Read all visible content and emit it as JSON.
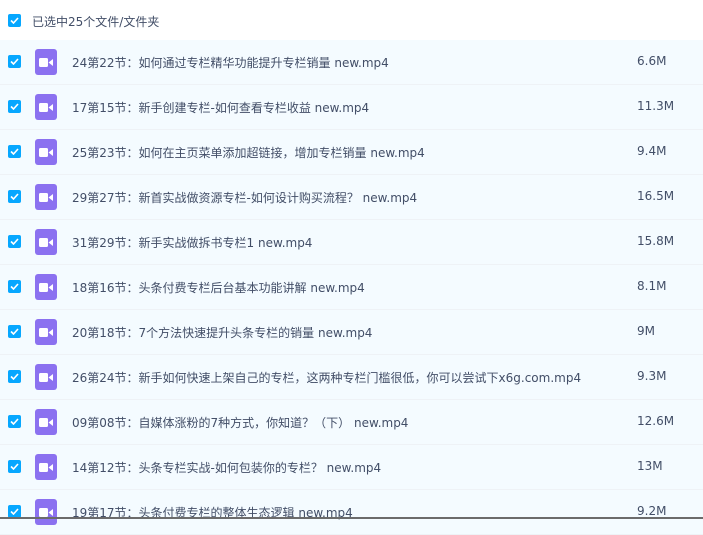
{
  "header": {
    "label": "已选中25个文件/文件夹"
  },
  "colors": {
    "accent": "#06a7ff",
    "video_icon": "#8b71f0",
    "row_bg": "#f4fbff"
  },
  "files": [
    {
      "name": "24第22节：如何通过专栏精华功能提升专栏销量 new.mp4",
      "size": "6.6M",
      "icon": "video-file-icon",
      "checked": true
    },
    {
      "name": "17第15节：新手创建专栏-如何查看专栏收益 new.mp4",
      "size": "11.3M",
      "icon": "video-file-icon",
      "checked": true
    },
    {
      "name": "25第23节：如何在主页菜单添加超链接，增加专栏销量 new.mp4",
      "size": "9.4M",
      "icon": "video-file-icon",
      "checked": true
    },
    {
      "name": "29第27节：新首实战做资源专栏-如何设计购买流程？ new.mp4",
      "size": "16.5M",
      "icon": "video-file-icon",
      "checked": true
    },
    {
      "name": "31第29节：新手实战做拆书专栏1 new.mp4",
      "size": "15.8M",
      "icon": "video-file-icon",
      "checked": true
    },
    {
      "name": "18第16节：头条付费专栏后台基本功能讲解 new.mp4",
      "size": "8.1M",
      "icon": "video-file-icon",
      "checked": true
    },
    {
      "name": "20第18节：7个方法快速提升头条专栏的销量 new.mp4",
      "size": "9M",
      "icon": "video-file-icon",
      "checked": true
    },
    {
      "name": "26第24节：新手如何快速上架自己的专栏，这两种专栏门槛很低，你可以尝试下x6g.com.mp4",
      "size": "9.3M",
      "icon": "video-file-icon",
      "checked": true
    },
    {
      "name": "09第08节：自媒体涨粉的7种方式，你知道？（下） new.mp4",
      "size": "12.6M",
      "icon": "video-file-icon",
      "checked": true
    },
    {
      "name": "14第12节：头条专栏实战-如何包装你的专栏？ new.mp4",
      "size": "13M",
      "icon": "video-file-icon",
      "checked": true
    },
    {
      "name": "19第17节：头条付费专栏的整体生态逻辑 new.mp4",
      "size": "9.2M",
      "icon": "video-file-icon",
      "checked": true
    }
  ]
}
